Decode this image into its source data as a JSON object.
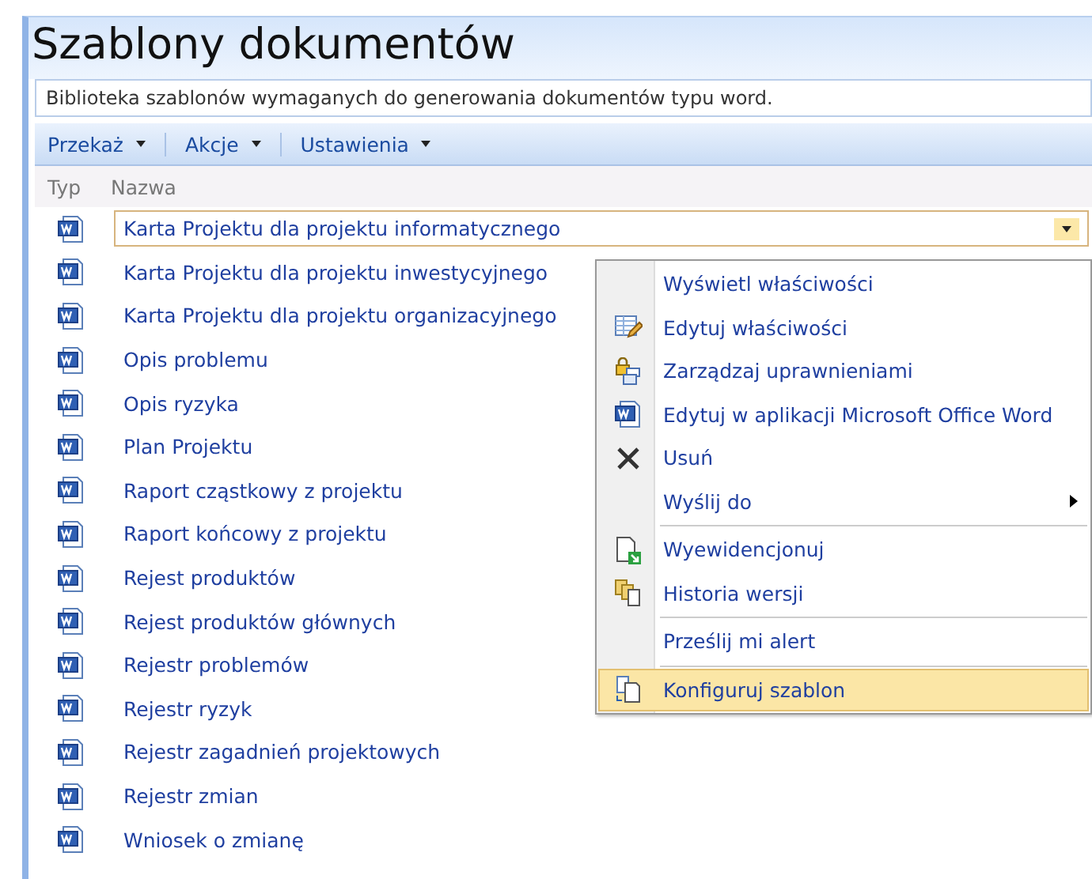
{
  "page": {
    "title": "Szablony dokumentów",
    "description": "Biblioteka szablonów wymaganych do generowania dokumentów typu word."
  },
  "toolbar": [
    {
      "label": "Przekaż"
    },
    {
      "label": "Akcje"
    },
    {
      "label": "Ustawienia"
    }
  ],
  "table": {
    "columns": [
      "Typ",
      "Nazwa"
    ],
    "rows": [
      {
        "name": "Karta Projektu dla projektu informatycznego",
        "selected": true
      },
      {
        "name": "Karta Projektu dla projektu inwestycyjnego",
        "selected": false
      },
      {
        "name": "Karta Projektu dla projektu organizacyjnego",
        "selected": false
      },
      {
        "name": "Opis problemu",
        "selected": false
      },
      {
        "name": "Opis ryzyka",
        "selected": false
      },
      {
        "name": "Plan Projektu",
        "selected": false
      },
      {
        "name": "Raport cząstkowy z projektu",
        "selected": false
      },
      {
        "name": "Raport końcowy z projektu",
        "selected": false
      },
      {
        "name": "Rejest produktów",
        "selected": false
      },
      {
        "name": "Rejest produktów głównych",
        "selected": false
      },
      {
        "name": "Rejestr problemów",
        "selected": false
      },
      {
        "name": "Rejestr ryzyk",
        "selected": false
      },
      {
        "name": "Rejestr zagadnień projektowych",
        "selected": false
      },
      {
        "name": "Rejestr zmian",
        "selected": false
      },
      {
        "name": "Wniosek o zmianę",
        "selected": false
      }
    ]
  },
  "context_menu": [
    {
      "kind": "plain",
      "label": "Wyświetl właściwości",
      "submenu": false,
      "selected": false
    },
    {
      "kind": "edit",
      "label": "Edytuj właściwości",
      "submenu": false,
      "selected": false
    },
    {
      "kind": "permissions",
      "label": "Zarządzaj uprawnieniami",
      "submenu": false,
      "selected": false
    },
    {
      "kind": "word",
      "label": "Edytuj w aplikacji Microsoft Office Word",
      "submenu": false,
      "selected": false
    },
    {
      "kind": "delete",
      "label": "Usuń",
      "submenu": false,
      "selected": false
    },
    {
      "kind": "plain",
      "label": "Wyślij do",
      "submenu": true,
      "selected": false
    },
    {
      "kind": "separator"
    },
    {
      "kind": "checkin",
      "label": "Wyewidencjonuj",
      "submenu": false,
      "selected": false
    },
    {
      "kind": "history",
      "label": "Historia wersji",
      "submenu": false,
      "selected": false
    },
    {
      "kind": "separator"
    },
    {
      "kind": "plain",
      "label": "Prześlij mi alert",
      "submenu": false,
      "selected": false
    },
    {
      "kind": "separator"
    },
    {
      "kind": "template",
      "label": "Konfiguruj szablon",
      "submenu": false,
      "selected": true
    }
  ]
}
